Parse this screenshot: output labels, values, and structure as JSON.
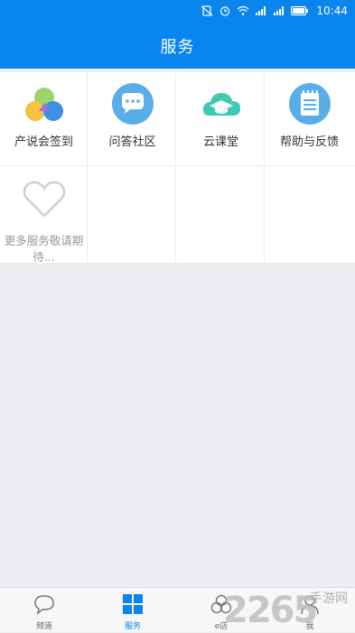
{
  "status_bar": {
    "time": "10:44"
  },
  "header": {
    "title": "服务"
  },
  "services": [
    {
      "label": "产说会签到",
      "icon": "triangle-circles-icon"
    },
    {
      "label": "问答社区",
      "icon": "chat-bubble-icon"
    },
    {
      "label": "云课堂",
      "icon": "cloud-graduation-cap-icon"
    },
    {
      "label": "帮助与反馈",
      "icon": "notepad-icon"
    }
  ],
  "more": {
    "label": "更多服务敬请期待...",
    "icon": "heart-outline-icon"
  },
  "tabbar": {
    "items": [
      {
        "label": "频道",
        "icon": "speech-bubble-icon",
        "active": false
      },
      {
        "label": "服务",
        "icon": "grid-squares-icon",
        "active": true
      },
      {
        "label": "e店",
        "icon": "circles-icon",
        "active": false
      },
      {
        "label": "我",
        "icon": "person-icon",
        "active": false
      }
    ]
  },
  "watermark": {
    "main": "2265",
    "sub": "手游网"
  },
  "colors": {
    "primary": "#0a85ee",
    "background": "#ededf2"
  }
}
